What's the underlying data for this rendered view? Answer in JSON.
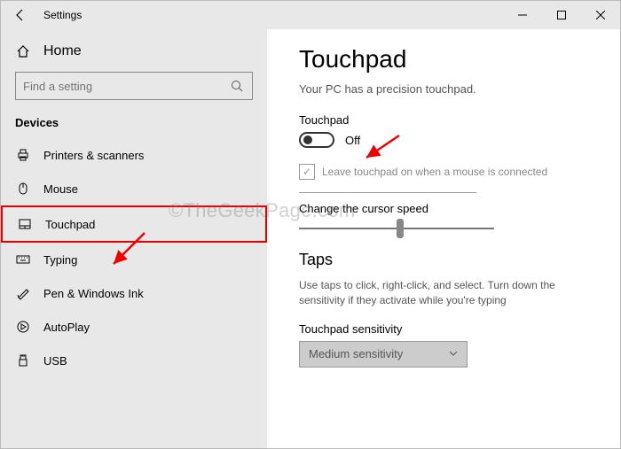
{
  "window_title": "Settings",
  "sidebar": {
    "home_label": "Home",
    "search_placeholder": "Find a setting",
    "section_label": "Devices",
    "items": [
      {
        "label": "Printers & scanners"
      },
      {
        "label": "Mouse"
      },
      {
        "label": "Touchpad"
      },
      {
        "label": "Typing"
      },
      {
        "label": "Pen & Windows Ink"
      },
      {
        "label": "AutoPlay"
      },
      {
        "label": "USB"
      }
    ]
  },
  "page": {
    "title": "Touchpad",
    "subtitle": "Your PC has a precision touchpad.",
    "toggle_label": "Touchpad",
    "toggle_state_text": "Off",
    "toggle_on": false,
    "checkbox_label": "Leave touchpad on when a mouse is connected",
    "checkbox_checked": true,
    "slider_label": "Change the cursor speed",
    "slider_value": 5,
    "slider_max": 10,
    "taps_title": "Taps",
    "taps_desc": "Use taps to click, right-click, and select. Turn down the sensitivity if they activate while you're typing",
    "sensitivity_label": "Touchpad sensitivity",
    "sensitivity_value": "Medium sensitivity"
  },
  "watermark": "©TheGeekPage.com"
}
